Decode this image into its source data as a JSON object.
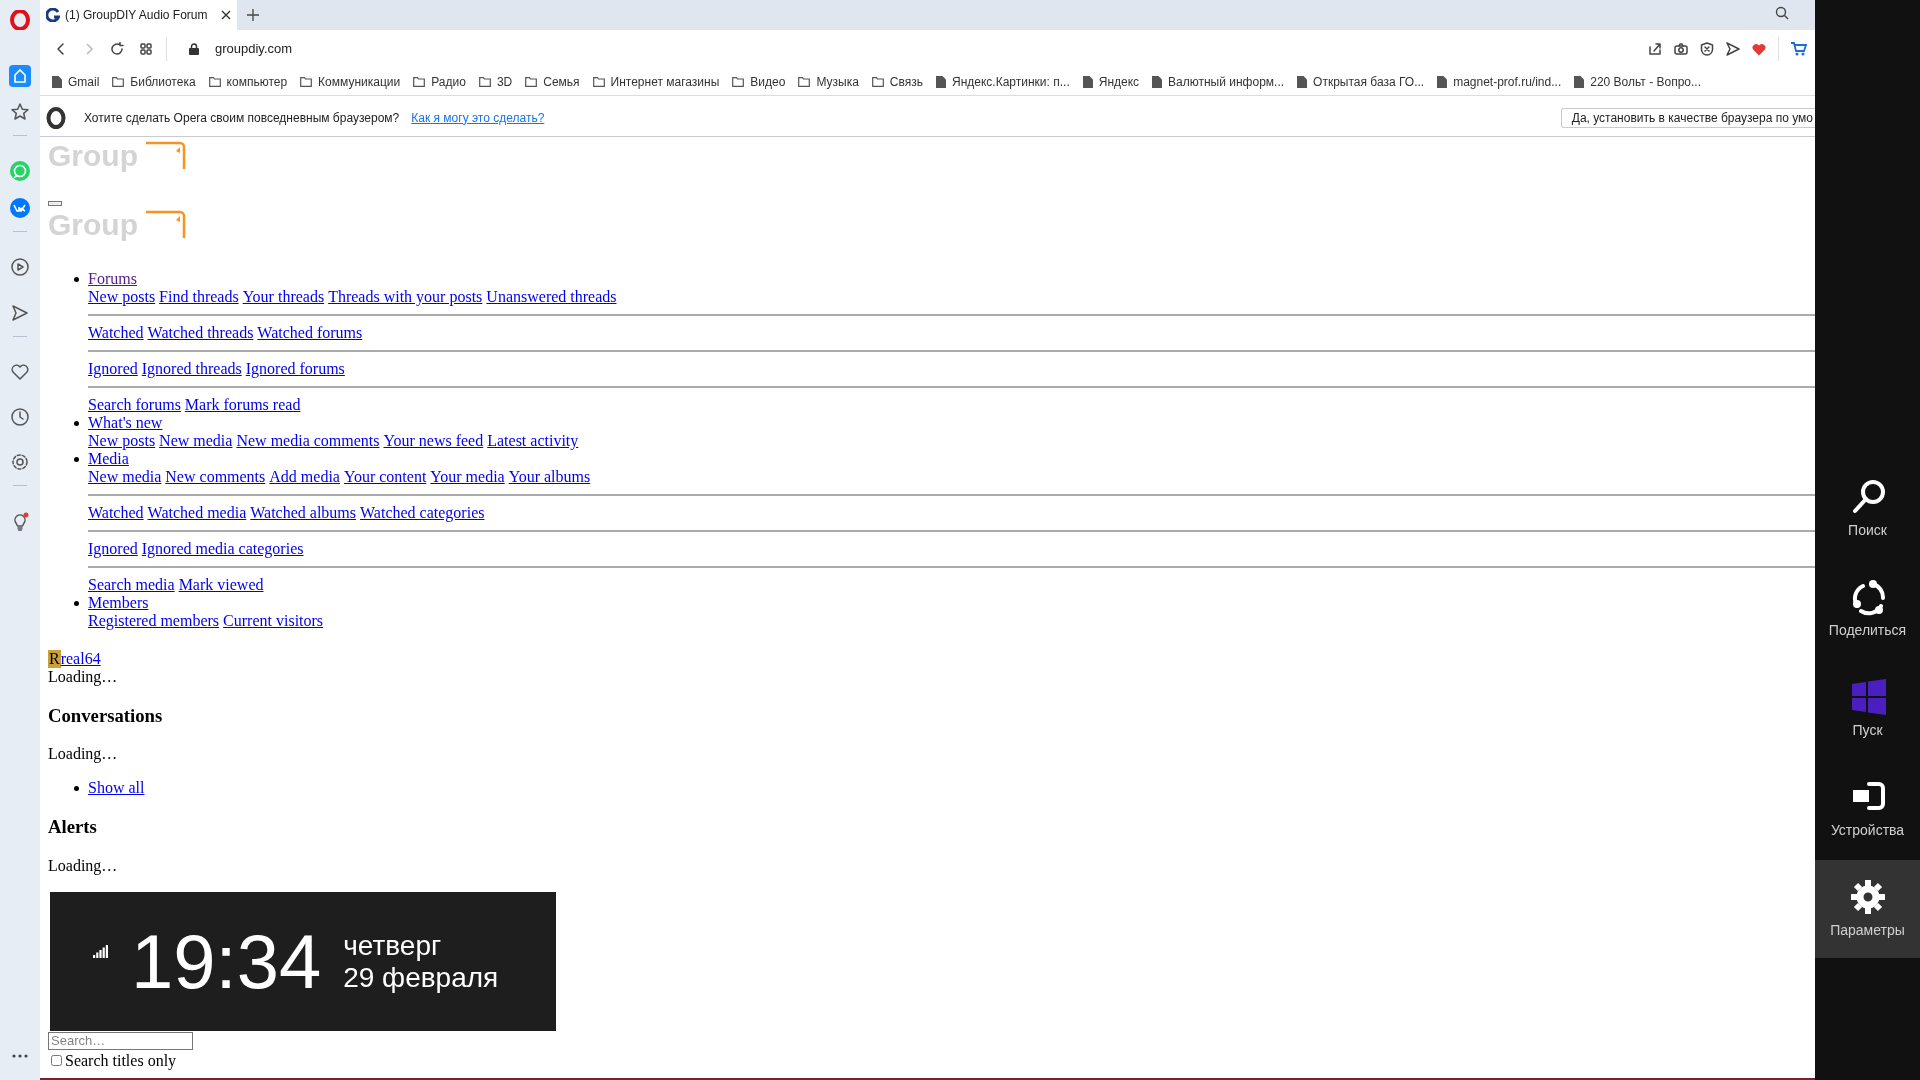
{
  "browser": {
    "tabs": [
      {
        "title": "(1) GroupDIY Audio Forum",
        "selected": true
      }
    ],
    "address": "groupdiy.com",
    "bookmarks": [
      {
        "label": "Gmail",
        "kind": "page"
      },
      {
        "label": "Библиотека",
        "kind": "folder"
      },
      {
        "label": "компьютер",
        "kind": "folder"
      },
      {
        "label": "Коммуникации",
        "kind": "folder"
      },
      {
        "label": "Радио",
        "kind": "folder"
      },
      {
        "label": "3D",
        "kind": "folder"
      },
      {
        "label": "Семья",
        "kind": "folder"
      },
      {
        "label": "Интернет магазины",
        "kind": "folder"
      },
      {
        "label": "Видео",
        "kind": "folder"
      },
      {
        "label": "Музыка",
        "kind": "folder"
      },
      {
        "label": "Связь",
        "kind": "folder"
      },
      {
        "label": "Яндекс.Картинки: п...",
        "kind": "page"
      },
      {
        "label": "Яндекс",
        "kind": "page"
      },
      {
        "label": "Валютный информ...",
        "kind": "page"
      },
      {
        "label": "Открытая база ГО...",
        "kind": "page"
      },
      {
        "label": "magnet-prof.ru/ind...",
        "kind": "page"
      },
      {
        "label": "220 Вольт - Вопро...",
        "kind": "page"
      }
    ],
    "notice": {
      "text": "Хотите сделать Opera своим повседневным браузером?",
      "link": "Как я могу это сделать?",
      "button": "Да, установить в качестве браузера по умо"
    }
  },
  "sidebar": {
    "items": [
      {
        "kind": "home",
        "selected": true
      },
      {
        "kind": "star",
        "selected": false
      },
      {
        "kind": "whatsapp",
        "selected": false
      },
      {
        "kind": "vk",
        "selected": false
      },
      {
        "kind": "player",
        "selected": false
      },
      {
        "kind": "send",
        "selected": false
      },
      {
        "kind": "heart",
        "selected": false
      },
      {
        "kind": "clock",
        "selected": false
      },
      {
        "kind": "gear",
        "selected": false
      },
      {
        "kind": "bulb",
        "selected": false
      }
    ]
  },
  "page": {
    "logos": [
      {
        "text": "Group"
      },
      {
        "text": "Group"
      }
    ],
    "nav": [
      {
        "label": "Forums",
        "visited": true,
        "groups": [
          [
            "New posts",
            "Find threads",
            "Your threads",
            "Threads with your posts",
            "Unanswered threads"
          ],
          [
            "Watched",
            "Watched threads",
            "Watched forums"
          ],
          [
            "Ignored",
            "Ignored threads",
            "Ignored forums"
          ],
          [
            "Search forums",
            "Mark forums read"
          ]
        ]
      },
      {
        "label": "What's new",
        "visited": false,
        "groups": [
          [
            "New posts",
            "New media",
            "New media comments",
            "Your news feed",
            "Latest activity"
          ]
        ]
      },
      {
        "label": "Media",
        "visited": false,
        "groups": [
          [
            "New media",
            "New comments",
            "Add media",
            "Your content",
            "Your media",
            "Your albums"
          ],
          [
            "Watched",
            "Watched media",
            "Watched albums",
            "Watched categories"
          ],
          [
            "Ignored",
            "Ignored media categories"
          ],
          [
            "Search media",
            "Mark viewed"
          ]
        ]
      },
      {
        "label": "Members",
        "visited": false,
        "groups": [
          [
            "Registered members",
            "Current visitors"
          ]
        ]
      }
    ],
    "user": {
      "initial": "R",
      "name": "real64"
    },
    "sections": [
      {
        "kind": "text",
        "text": "Loading…"
      },
      {
        "kind": "heading",
        "text": "Conversations"
      },
      {
        "kind": "text",
        "text": "Loading…"
      },
      {
        "kind": "links",
        "items": [
          "Show all"
        ]
      },
      {
        "kind": "heading",
        "text": "Alerts"
      },
      {
        "kind": "text",
        "text": "Loading…"
      },
      {
        "kind": "input",
        "placeholder": "Search…"
      },
      {
        "kind": "checkbox",
        "label": "Search titles only",
        "checked": false
      }
    ]
  },
  "clock": {
    "time": "19:34",
    "day": "четверг",
    "date": "29 февраля"
  },
  "charms": [
    {
      "kind": "search",
      "label": "Поиск",
      "selected": false
    },
    {
      "kind": "share",
      "label": "Поделиться",
      "selected": false
    },
    {
      "kind": "start",
      "label": "Пуск",
      "selected": false
    },
    {
      "kind": "devices",
      "label": "Устройства",
      "selected": false
    },
    {
      "kind": "settings",
      "label": "Параметры",
      "selected": true
    }
  ]
}
